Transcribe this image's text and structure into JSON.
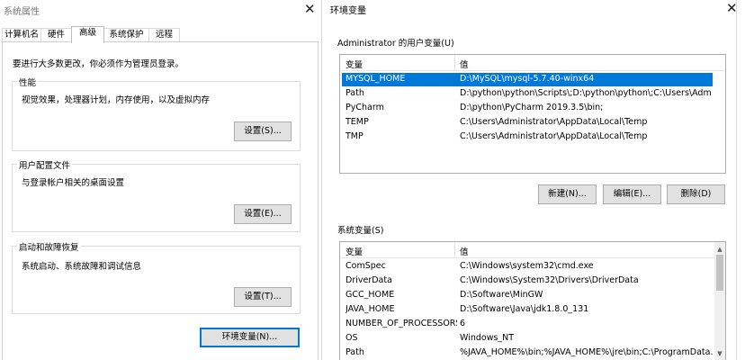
{
  "left_window": {
    "title": "系统属性",
    "close_glyph": "✕",
    "tabs": [
      "计算机名",
      "硬件",
      "高级",
      "系统保护",
      "远程"
    ],
    "admin_note": "要进行大多数更改，你必须作为管理员登录。",
    "performance": {
      "label": "性能",
      "desc": "视觉效果，处理器计划，内存使用，以及虚拟内存",
      "button": "设置(S)..."
    },
    "user_profiles": {
      "label": "用户配置文件",
      "desc": "与登录帐户相关的桌面设置",
      "button": "设置(E)..."
    },
    "startup": {
      "label": "启动和故障恢复",
      "desc": "系统启动、系统故障和调试信息",
      "button": "设置(T)..."
    },
    "env_button": "环境变量(N)..."
  },
  "right_window": {
    "title": "环境变量",
    "close_glyph": "✕",
    "user_section_label": "Administrator 的用户变量(U)",
    "user_columns": [
      "变量",
      "值"
    ],
    "user_vars": [
      {
        "name": "MYSQL_HOME",
        "value": "D:\\MySQL\\mysql-5.7.40-winx64"
      },
      {
        "name": "Path",
        "value": "D:\\python\\python\\Scripts\\;D:\\python\\python\\;C:\\Users\\Admin..."
      },
      {
        "name": "PyCharm",
        "value": "D:\\python\\PyCharm 2019.3.5\\bin;"
      },
      {
        "name": "TEMP",
        "value": "C:\\Users\\Administrator\\AppData\\Local\\Temp"
      },
      {
        "name": "TMP",
        "value": "C:\\Users\\Administrator\\AppData\\Local\\Temp"
      }
    ],
    "user_buttons": {
      "new": "新建(N)...",
      "edit": "编辑(E)...",
      "delete": "删除(D)"
    },
    "system_section_label": "系统变量(S)",
    "system_columns": [
      "变量",
      "值"
    ],
    "system_vars": [
      {
        "name": "ComSpec",
        "value": "C:\\Windows\\system32\\cmd.exe"
      },
      {
        "name": "DriverData",
        "value": "C:\\Windows\\System32\\Drivers\\DriverData"
      },
      {
        "name": "GCC_HOME",
        "value": "D:\\Software\\MinGW"
      },
      {
        "name": "JAVA_HOME",
        "value": "D:\\Software\\Java\\jdk1.8.0_131"
      },
      {
        "name": "NUMBER_OF_PROCESSORS",
        "value": "6"
      },
      {
        "name": "OS",
        "value": "Windows_NT"
      },
      {
        "name": "Path",
        "value": "%JAVA_HOME%\\bin;%JAVA_HOME%\\jre\\bin;C:\\ProgramData..."
      }
    ],
    "scroll_up_glyph": "▲",
    "scroll_down_glyph": "▼"
  },
  "colors": {
    "selection": "#0078d7",
    "button_face": "#e1e1e1",
    "default_border": "#0078d7"
  }
}
